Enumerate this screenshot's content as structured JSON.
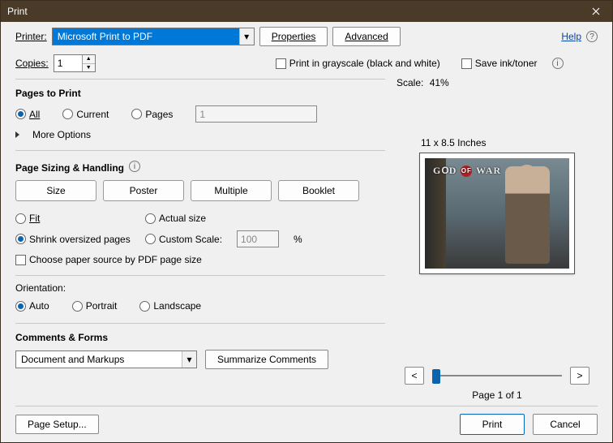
{
  "title": "Print",
  "help": "Help",
  "printerLabel": "Printer:",
  "printerValue": "Microsoft Print to PDF",
  "propertiesBtn": "Properties",
  "advancedBtn": "Advanced",
  "copiesLabel": "Copies:",
  "copiesValue": "1",
  "grayscale": "Print in grayscale (black and white)",
  "saveInk": "Save ink/toner",
  "pagesToPrint": {
    "title": "Pages to Print",
    "all": "All",
    "current": "Current",
    "pages": "Pages",
    "pagesValue": "1",
    "more": "More Options"
  },
  "sizing": {
    "title": "Page Sizing & Handling",
    "size": "Size",
    "poster": "Poster",
    "multiple": "Multiple",
    "booklet": "Booklet",
    "fit": "Fit",
    "actual": "Actual size",
    "shrink": "Shrink oversized pages",
    "custom": "Custom Scale:",
    "customValue": "100",
    "pct": "%",
    "paperSource": "Choose paper source by PDF page size"
  },
  "orientation": {
    "title": "Orientation:",
    "auto": "Auto",
    "portrait": "Portrait",
    "landscape": "Landscape"
  },
  "comments": {
    "title": "Comments & Forms",
    "value": "Document and Markups",
    "summarize": "Summarize Comments"
  },
  "preview": {
    "scaleLabel": "Scale:",
    "scaleValue": "41%",
    "paper": "11 x 8.5 Inches",
    "gow": "GOD OF WAR",
    "page": "Page 1 of 1"
  },
  "footer": {
    "pageSetup": "Page Setup...",
    "print": "Print",
    "cancel": "Cancel"
  }
}
